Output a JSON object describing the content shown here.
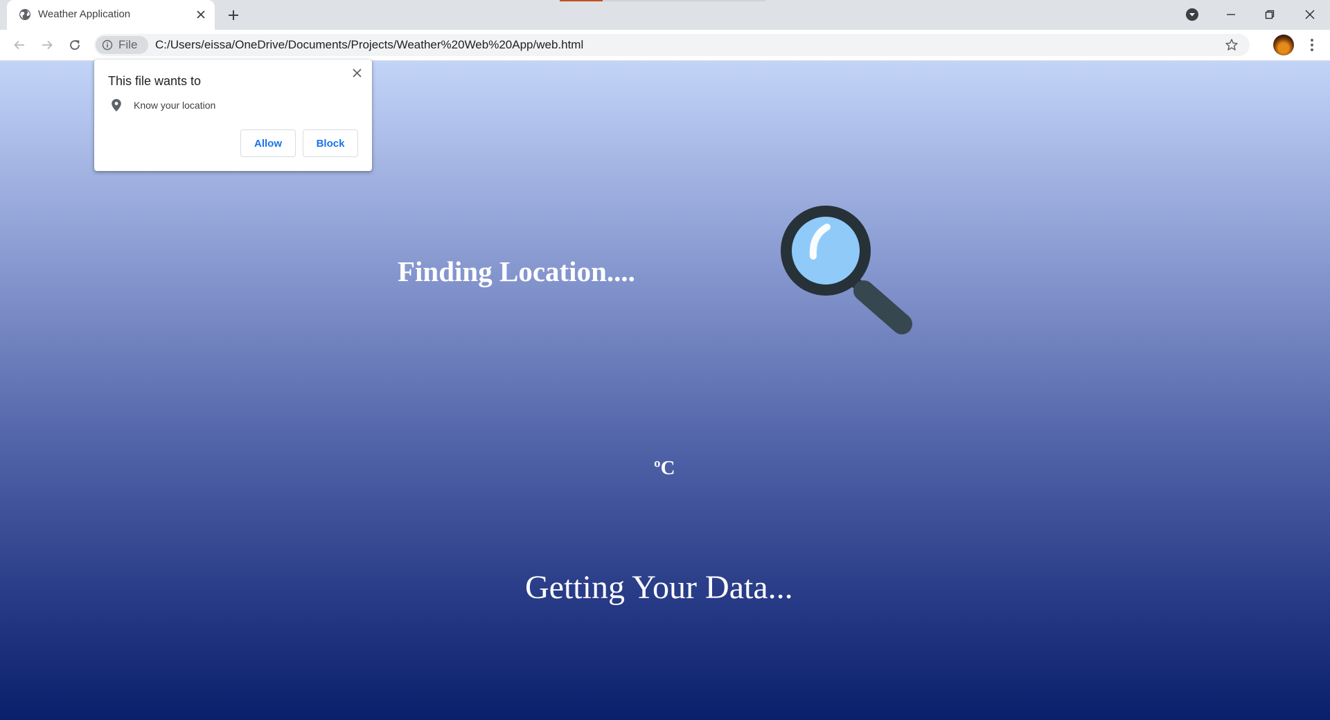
{
  "browser": {
    "tab": {
      "title": "Weather Application"
    },
    "omnibox": {
      "scheme_label": "File",
      "url": "C:/Users/eissa/OneDrive/Documents/Projects/Weather%20Web%20App/web.html"
    }
  },
  "permission_popup": {
    "title": "This file wants to",
    "permission": "Know your location",
    "allow_label": "Allow",
    "block_label": "Block"
  },
  "page": {
    "location_status": "Finding Location....",
    "temperature_unit": "ºC",
    "data_status": "Getting Your Data..."
  },
  "icons": {
    "favicon": "globe-icon",
    "status": "magnifying-glass-icon",
    "location": "location-pin-icon"
  },
  "colors": {
    "page_gradient_top": "#c3d4f8",
    "page_gradient_bottom": "#0a1f6b",
    "magnifier_lens": "#90caf9",
    "magnifier_frame": "#263238",
    "link_blue": "#1a73e8"
  }
}
